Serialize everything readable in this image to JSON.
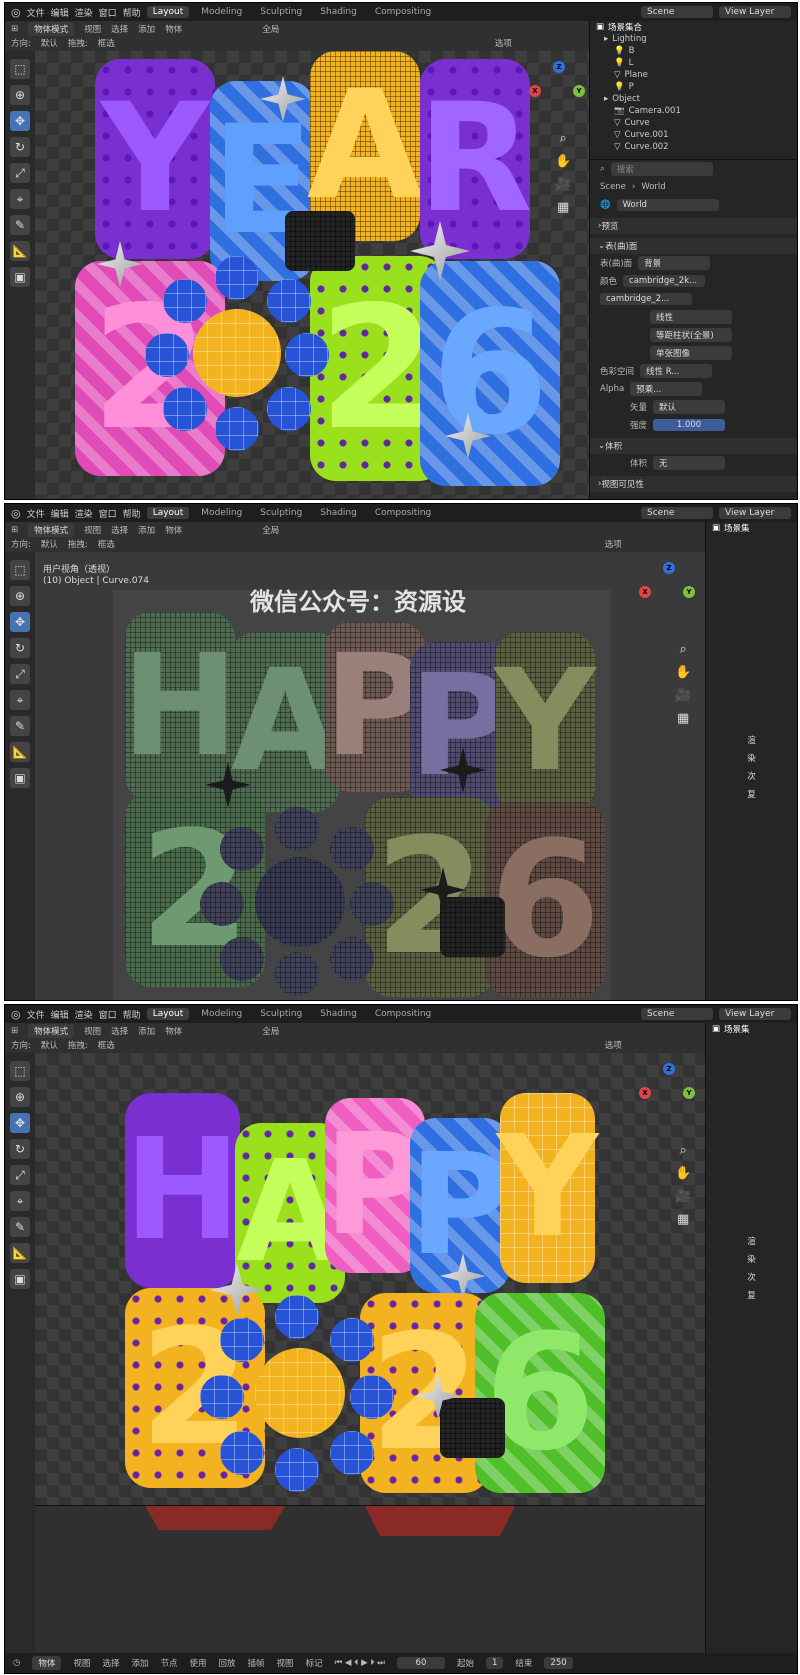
{
  "menu": {
    "items": [
      "文件",
      "编辑",
      "渲染",
      "窗口",
      "帮助"
    ],
    "workspaces": [
      "Layout",
      "Modeling",
      "Sculpting",
      "Shading",
      "Compositing"
    ],
    "active_workspace": "Layout",
    "scene": "Scene",
    "view_layer": "View Layer"
  },
  "header": {
    "mode": "物体模式",
    "menus": [
      "视图",
      "选择",
      "添加",
      "物体"
    ],
    "orientation_label": "方向:",
    "orientation_value": "默认",
    "drag_label": "拖拽:",
    "drag_value": "框选",
    "global": "全局",
    "options": "选项"
  },
  "panel1": {
    "outliner_title": "场景集合",
    "outliner_rows": [
      "Lighting",
      "B",
      "L",
      "Plane",
      "P",
      "Object",
      "Camera.001",
      "Curve",
      "Curve.001",
      "Curve.002"
    ],
    "search_placeholder": "搜索",
    "breadcrumb_scene": "Scene",
    "breadcrumb_world": "World",
    "world_name": "World",
    "section_preview": "预览",
    "section_surface": "表(曲)面",
    "surface_label": "表(曲)面",
    "surface_value": "背景",
    "color_label": "颜色",
    "color_value": "cambridge_2k...",
    "image_value": "cambridge_2...",
    "interp_value": "线性",
    "proj_value": "等距柱状(全景)",
    "ext_value": "单张图像",
    "colorspace_label": "色彩空间",
    "colorspace_value": "线性 R...",
    "alpha_label": "Alpha",
    "alpha_value": "预乘...",
    "vector_label": "矢量",
    "vector_value": "默认",
    "strength_label": "强度",
    "strength_value": "1.000",
    "section_volume": "体积",
    "volume_label": "体积",
    "volume_value": "无",
    "section_viewport": "视图可见性",
    "letters_top": [
      "Y",
      "E",
      "A",
      "R"
    ],
    "letters_bottom": [
      "2",
      "2",
      "6"
    ]
  },
  "panel2": {
    "outliner_title": "场景集",
    "overlay_line1": "用户视角（透视）",
    "overlay_line2": "(10) Object | Curve.074",
    "watermark": "微信公众号：资源设",
    "letters_top": [
      "H",
      "A",
      "P",
      "P",
      "Y"
    ],
    "letters_bottom": [
      "2",
      "2",
      "6"
    ],
    "side_labels": [
      "渲",
      "染",
      "次",
      "复"
    ]
  },
  "panel3": {
    "outliner_title": "场景集",
    "letters_top": [
      "H",
      "A",
      "P",
      "P",
      "Y"
    ],
    "letters_bottom": [
      "2",
      "2",
      "6"
    ],
    "side_labels": [
      "渲",
      "染",
      "次",
      "复"
    ]
  },
  "timeline": {
    "mode": "物体",
    "menus": [
      "视图",
      "选择",
      "添加",
      "节点"
    ],
    "use_nodes": "使用",
    "playback": "回放",
    "keying": "插帧",
    "view": "视图",
    "marker": "标记",
    "current_frame": "60",
    "start_label": "起始",
    "start_value": "1",
    "end_label": "结束",
    "end_value": "250"
  },
  "colors": {
    "accent": "#4772b3",
    "purple": "#7a2fd0",
    "blue": "#2f6fe0",
    "yellow": "#f3b21f",
    "green": "#9be01c",
    "pink": "#ef5fc0"
  }
}
